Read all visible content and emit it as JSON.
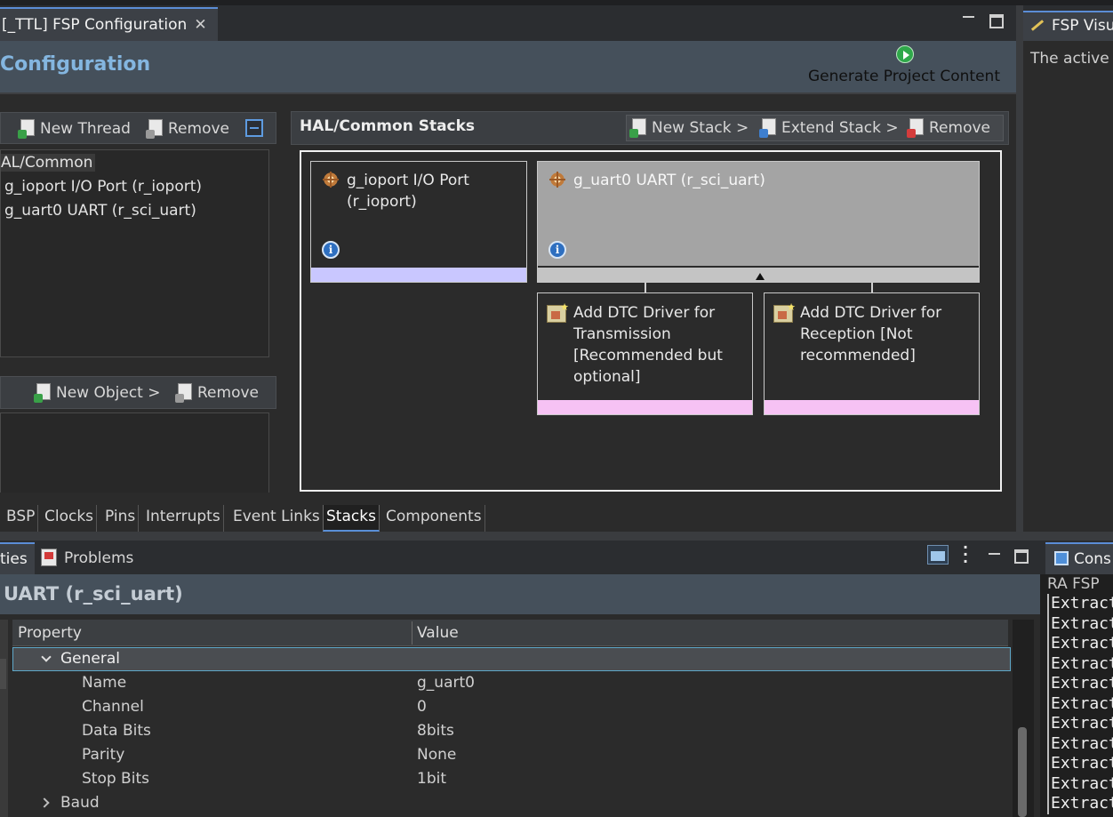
{
  "editor": {
    "tab_label": "[_TTL] FSP Configuration",
    "tab_close": "✕",
    "page_title": "Configuration",
    "generate_label": "Generate Project Content"
  },
  "threads": {
    "new_thread": "New Thread",
    "remove": "Remove",
    "tree_root": "AL/Common",
    "tree_items": [
      "g_ioport I/O Port (r_ioport)",
      "g_uart0 UART (r_sci_uart)"
    ]
  },
  "objects": {
    "new_object": "New Object >",
    "remove": "Remove"
  },
  "stacks": {
    "title": "HAL/Common Stacks",
    "new_stack": "New Stack >",
    "extend_stack": "Extend Stack >",
    "remove": "Remove",
    "ioport_block": "g_ioport I/O Port (r_ioport)",
    "uart_block": "g_uart0 UART (r_sci_uart)",
    "dtc_tx": "Add DTC Driver for Transmission [Recommended but optional]",
    "dtc_rx": "Add DTC Driver for Reception [Not recommended]",
    "info_glyph": "i",
    "colors": {
      "ioport_bar": "#c9c7ff",
      "dtc_bar": "#f6c2f4",
      "uart_block_bg": "#a4a4a4"
    }
  },
  "editor_tabs": [
    {
      "label": "BSP",
      "active": false
    },
    {
      "label": "Clocks",
      "active": false
    },
    {
      "label": "Pins",
      "active": false
    },
    {
      "label": "Interrupts",
      "active": false
    },
    {
      "label": "Event Links",
      "active": false
    },
    {
      "label": "Stacks",
      "active": true
    },
    {
      "label": "Components",
      "active": false
    }
  ],
  "visualizer": {
    "tab_label": "FSP Visu",
    "text": "The active c"
  },
  "properties": {
    "tab_properties": "ties",
    "tab_problems": "Problems",
    "title": "UART (r_sci_uart)",
    "col_property": "Property",
    "col_value": "Value",
    "group_general": "General",
    "rows": [
      {
        "name": "Name",
        "value": "g_uart0"
      },
      {
        "name": "Channel",
        "value": "0"
      },
      {
        "name": "Data Bits",
        "value": "8bits"
      },
      {
        "name": "Parity",
        "value": "None"
      },
      {
        "name": "Stop Bits",
        "value": "1bit"
      }
    ],
    "group_baud": "Baud"
  },
  "console": {
    "tab_label": "Cons",
    "label": "RA FSP",
    "lines": [
      "Extract",
      "Extract",
      "Extract",
      "Extract",
      "Extract",
      "Extract",
      "Extract",
      "Extract",
      "Extract",
      "Extract",
      "Extract"
    ]
  }
}
